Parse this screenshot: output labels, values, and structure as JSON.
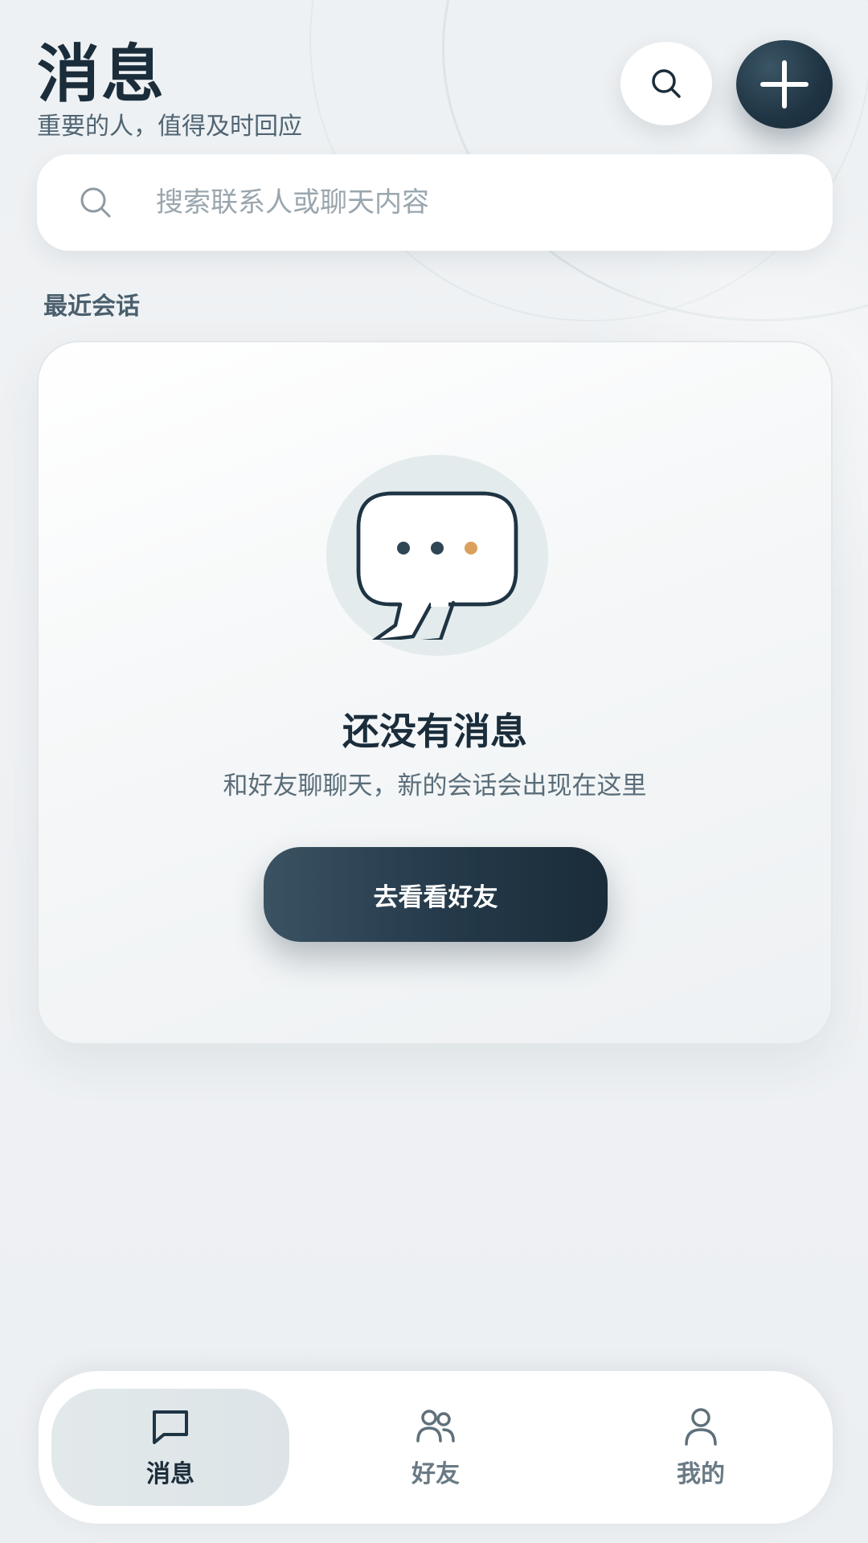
{
  "header": {
    "title": "消息",
    "subtitle": "重要的人，值得及时回应"
  },
  "search": {
    "placeholder": "搜索联系人或聊天内容",
    "value": ""
  },
  "section": {
    "recent_label": "最近会话"
  },
  "empty_state": {
    "title": "还没有消息",
    "description": "和好友聊聊天，新的会话会出现在这里",
    "cta_label": "去看看好友"
  },
  "bottom_nav": {
    "items": [
      {
        "label": "消息",
        "icon": "message-icon",
        "active": true
      },
      {
        "label": "好友",
        "icon": "friends-icon",
        "active": false
      },
      {
        "label": "我的",
        "icon": "profile-icon",
        "active": false
      }
    ]
  },
  "colors": {
    "primary_dark": "#1f3443",
    "accent_dot": "#d9a15c",
    "background": "#eef1f3"
  }
}
